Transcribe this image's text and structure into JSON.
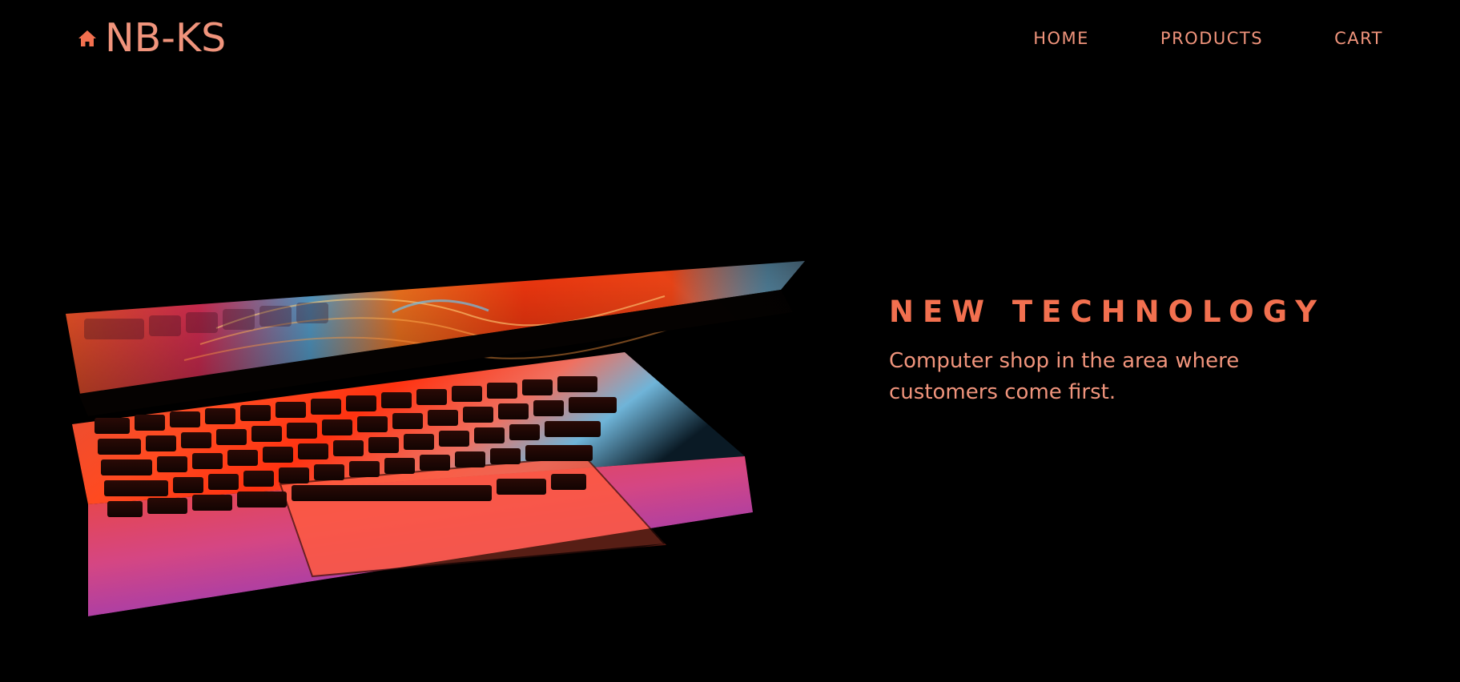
{
  "header": {
    "brand": {
      "icon": "home-icon",
      "name": "NB-KS"
    },
    "nav": [
      {
        "label": "HOME"
      },
      {
        "label": "PRODUCTS"
      },
      {
        "label": "CART"
      }
    ]
  },
  "hero": {
    "image": "laptop-photo",
    "title": "NEW TECHNOLOGY",
    "subtitle": "Computer shop in the area where customers come first."
  },
  "colors": {
    "background": "#000000",
    "accent": "#f0947c",
    "title": "#f2704f"
  }
}
